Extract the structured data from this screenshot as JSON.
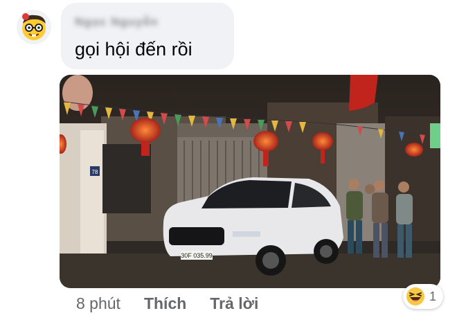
{
  "comment": {
    "author_name": "Ngọc Nguyễn",
    "text": "gọi hội đến rồi",
    "avatar_icon": "nerd-face-avatar-icon",
    "photo": {
      "description_icon": "street-night-photo",
      "house_number": "78",
      "license_plate": "30F 035.99"
    }
  },
  "actions": {
    "time": "8 phút",
    "like_label": "Thích",
    "reply_label": "Trả lời"
  },
  "reactions": {
    "icon": "laughing-emoji-icon",
    "count": "1"
  },
  "colors": {
    "bubble": "#f0f2f5",
    "meta_text": "#65676b",
    "text": "#050505"
  }
}
